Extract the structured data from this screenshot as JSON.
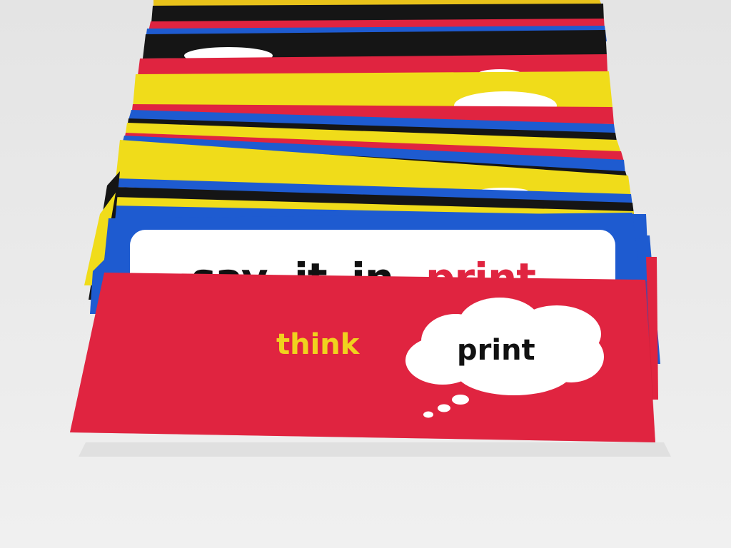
{
  "scene": {
    "front_card": {
      "word_think": "think",
      "word_print": "print"
    },
    "second_card": {
      "word_say": "say",
      "word_it": "it",
      "word_in": "in",
      "word_print": "print"
    }
  },
  "colors": {
    "table": "#ebebeb",
    "card_red": "#e02440",
    "card_yellow": "#f0dc1a",
    "card_blue": "#1e5bd0",
    "card_black": "#151515",
    "bubble_white": "#ffffff",
    "think_yellow": "#f0d21e",
    "print_black": "#111111"
  }
}
